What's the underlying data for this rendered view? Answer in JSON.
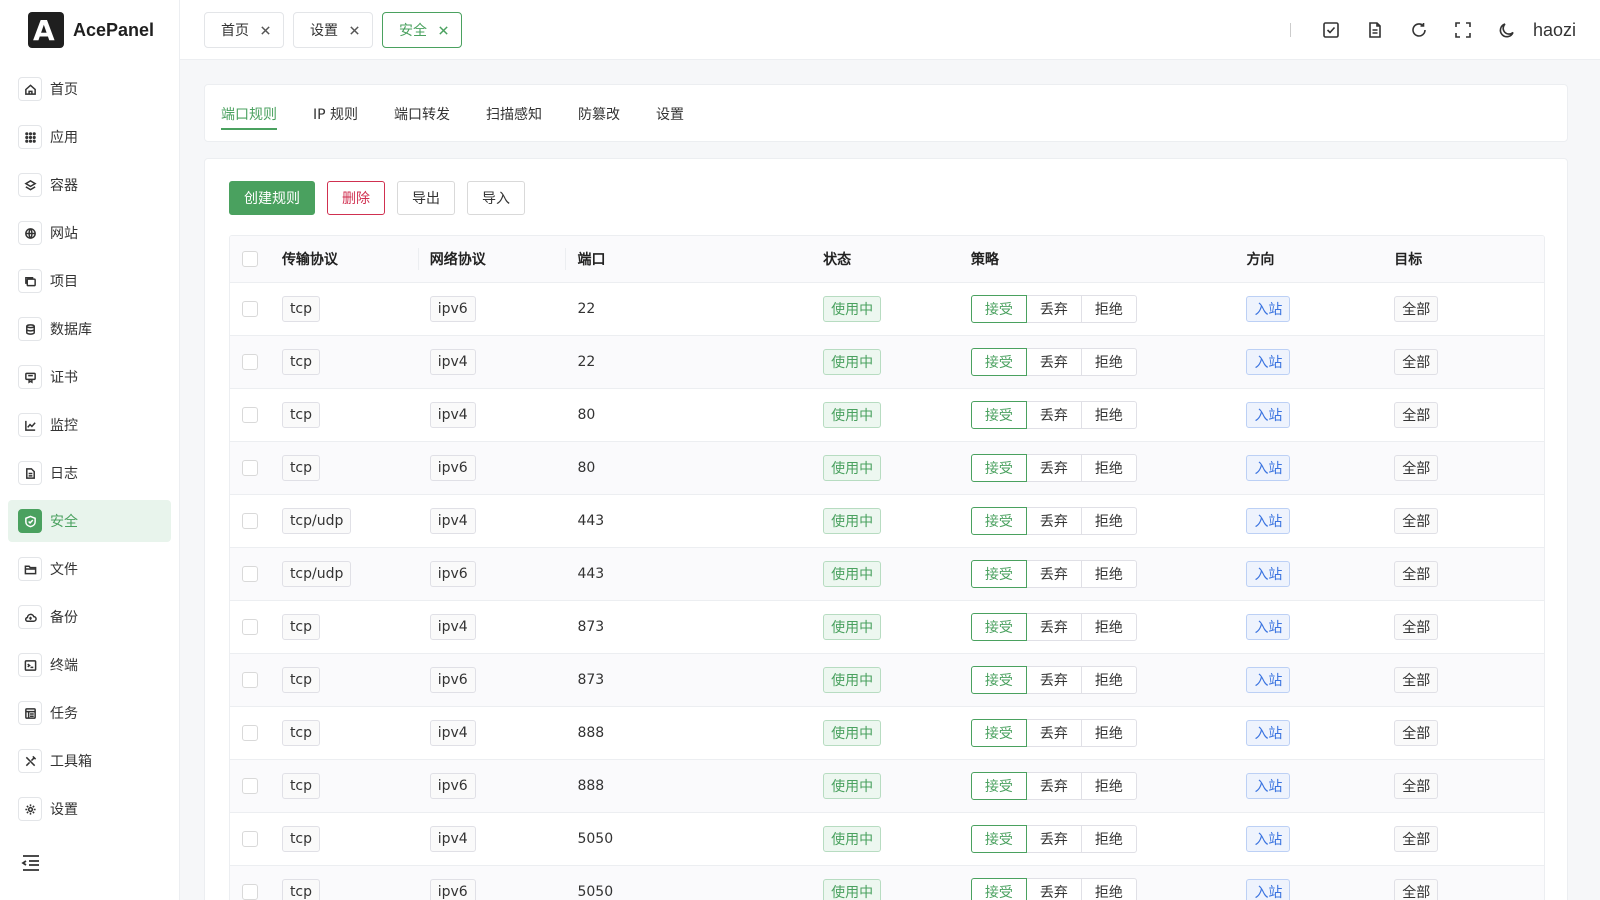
{
  "app": {
    "name": "AcePanel",
    "logo_letter": "A"
  },
  "sidebar": {
    "items": [
      {
        "label": "首页",
        "icon": "home-icon"
      },
      {
        "label": "应用",
        "icon": "apps-icon"
      },
      {
        "label": "容器",
        "icon": "layers-icon"
      },
      {
        "label": "网站",
        "icon": "globe-icon"
      },
      {
        "label": "项目",
        "icon": "folders-icon"
      },
      {
        "label": "数据库",
        "icon": "database-icon"
      },
      {
        "label": "证书",
        "icon": "certificate-icon"
      },
      {
        "label": "监控",
        "icon": "chart-icon"
      },
      {
        "label": "日志",
        "icon": "log-icon"
      },
      {
        "label": "安全",
        "icon": "shield-icon",
        "active": true
      },
      {
        "label": "文件",
        "icon": "folder-icon"
      },
      {
        "label": "备份",
        "icon": "cloud-icon"
      },
      {
        "label": "终端",
        "icon": "terminal-icon"
      },
      {
        "label": "任务",
        "icon": "tasks-icon"
      },
      {
        "label": "工具箱",
        "icon": "tools-icon"
      },
      {
        "label": "设置",
        "icon": "gear-icon"
      }
    ]
  },
  "header": {
    "tabs": [
      {
        "label": "首页"
      },
      {
        "label": "设置"
      },
      {
        "label": "安全",
        "active": true
      }
    ],
    "user": "haozi"
  },
  "subtabs": [
    {
      "label": "端口规则",
      "active": true
    },
    {
      "label": "IP 规则"
    },
    {
      "label": "端口转发"
    },
    {
      "label": "扫描感知"
    },
    {
      "label": "防篡改"
    },
    {
      "label": "设置"
    }
  ],
  "toolbar": {
    "create_label": "创建规则",
    "delete_label": "删除",
    "export_label": "导出",
    "import_label": "导入"
  },
  "table": {
    "headers": {
      "transport": "传输协议",
      "network": "网络协议",
      "port": "端口",
      "status": "状态",
      "policy": "策略",
      "direction": "方向",
      "target": "目标"
    },
    "policy_options": [
      "接受",
      "丢弃",
      "拒绝"
    ],
    "rows": [
      {
        "transport": "tcp",
        "network": "ipv6",
        "port": "22",
        "status": "使用中",
        "policy": "接受",
        "direction": "入站",
        "target": "全部"
      },
      {
        "transport": "tcp",
        "network": "ipv4",
        "port": "22",
        "status": "使用中",
        "policy": "接受",
        "direction": "入站",
        "target": "全部"
      },
      {
        "transport": "tcp",
        "network": "ipv4",
        "port": "80",
        "status": "使用中",
        "policy": "接受",
        "direction": "入站",
        "target": "全部"
      },
      {
        "transport": "tcp",
        "network": "ipv6",
        "port": "80",
        "status": "使用中",
        "policy": "接受",
        "direction": "入站",
        "target": "全部"
      },
      {
        "transport": "tcp/udp",
        "network": "ipv4",
        "port": "443",
        "status": "使用中",
        "policy": "接受",
        "direction": "入站",
        "target": "全部"
      },
      {
        "transport": "tcp/udp",
        "network": "ipv6",
        "port": "443",
        "status": "使用中",
        "policy": "接受",
        "direction": "入站",
        "target": "全部"
      },
      {
        "transport": "tcp",
        "network": "ipv4",
        "port": "873",
        "status": "使用中",
        "policy": "接受",
        "direction": "入站",
        "target": "全部"
      },
      {
        "transport": "tcp",
        "network": "ipv6",
        "port": "873",
        "status": "使用中",
        "policy": "接受",
        "direction": "入站",
        "target": "全部"
      },
      {
        "transport": "tcp",
        "network": "ipv4",
        "port": "888",
        "status": "使用中",
        "policy": "接受",
        "direction": "入站",
        "target": "全部"
      },
      {
        "transport": "tcp",
        "network": "ipv6",
        "port": "888",
        "status": "使用中",
        "policy": "接受",
        "direction": "入站",
        "target": "全部"
      },
      {
        "transport": "tcp",
        "network": "ipv4",
        "port": "5050",
        "status": "使用中",
        "policy": "接受",
        "direction": "入站",
        "target": "全部"
      },
      {
        "transport": "tcp",
        "network": "ipv6",
        "port": "5050",
        "status": "使用中",
        "policy": "接受",
        "direction": "入站",
        "target": "全部"
      }
    ]
  },
  "colors": {
    "accent": "#4aa15f",
    "danger": "#d03050",
    "info": "#3b74e0"
  }
}
